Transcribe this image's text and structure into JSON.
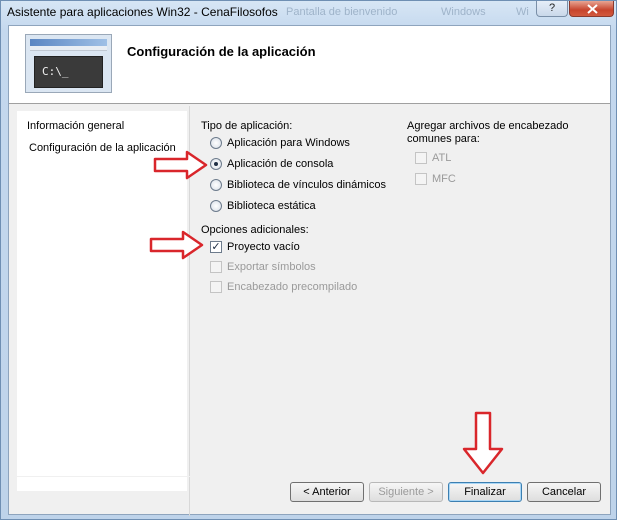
{
  "window": {
    "title": "Asistente para aplicaciones Win32 - CenaFilosofos",
    "ghost_title_1": "Pantalla de bienvenido",
    "ghost_title_2": "Windows",
    "ghost_title_3": "Wi",
    "help_label": "?"
  },
  "header": {
    "title": "Configuración de la aplicación",
    "image_text": "C:\\_"
  },
  "nav": {
    "items": [
      {
        "label": "Información general"
      },
      {
        "label": "Configuración de la aplicación"
      }
    ]
  },
  "app_type": {
    "label": "Tipo de aplicación:",
    "options": [
      {
        "label": "Aplicación para Windows",
        "selected": false
      },
      {
        "label": "Aplicación de consola",
        "selected": true
      },
      {
        "label": "Biblioteca de vínculos dinámicos",
        "selected": false
      },
      {
        "label": "Biblioteca estática",
        "selected": false
      }
    ]
  },
  "additional": {
    "label": "Opciones adicionales:",
    "options": [
      {
        "label": "Proyecto vacío",
        "checked": true,
        "enabled": true
      },
      {
        "label": "Exportar símbolos",
        "checked": false,
        "enabled": false
      },
      {
        "label": "Encabezado precompilado",
        "checked": false,
        "enabled": false
      }
    ]
  },
  "headers": {
    "label_line1": "Agregar archivos de encabezado",
    "label_line2": "comunes para:",
    "options": [
      {
        "label": "ATL",
        "checked": false,
        "enabled": false
      },
      {
        "label": "MFC",
        "checked": false,
        "enabled": false
      }
    ]
  },
  "buttons": {
    "back": "< Anterior",
    "next": "Siguiente >",
    "finish": "Finalizar",
    "cancel": "Cancelar"
  },
  "colors": {
    "annotation_arrow": "#d9262b"
  }
}
